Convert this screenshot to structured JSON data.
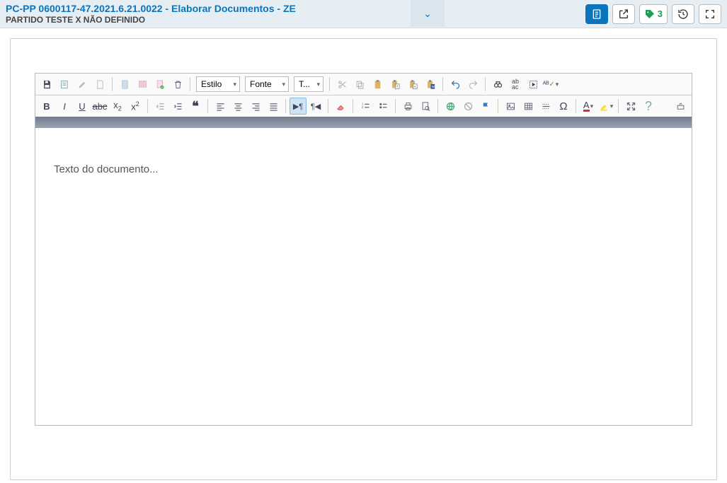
{
  "header": {
    "title": "PC-PP 0600117-47.2021.6.21.0022 - Elaborar Documentos - ZE",
    "subtitle": "PARTIDO TESTE X NÃO DEFINIDO",
    "tag_count": "3"
  },
  "toolbar": {
    "combos": {
      "style": "Estilo",
      "font": "Fonte",
      "size": "T..."
    }
  },
  "document": {
    "placeholder": "Texto do documento..."
  }
}
